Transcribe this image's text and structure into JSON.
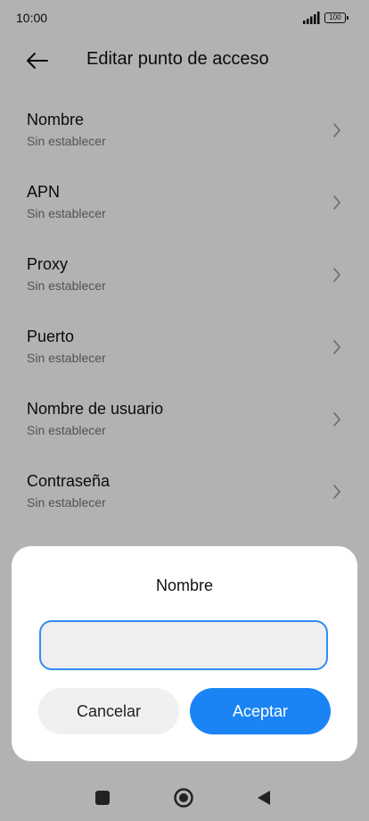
{
  "status_bar": {
    "time": "10:00",
    "battery": "100"
  },
  "header": {
    "title": "Editar punto de acceso",
    "back_icon": "arrow-left-icon"
  },
  "list": {
    "items": [
      {
        "title": "Nombre",
        "subtitle": "Sin establecer"
      },
      {
        "title": "APN",
        "subtitle": "Sin establecer"
      },
      {
        "title": "Proxy",
        "subtitle": "Sin establecer"
      },
      {
        "title": "Puerto",
        "subtitle": "Sin establecer"
      },
      {
        "title": "Nombre de usuario",
        "subtitle": "Sin establecer"
      },
      {
        "title": "Contraseña",
        "subtitle": "Sin establecer"
      }
    ]
  },
  "dialog": {
    "title": "Nombre",
    "input_value": "",
    "cancel_label": "Cancelar",
    "ok_label": "Aceptar"
  },
  "colors": {
    "accent": "#1a84f5",
    "input_border": "#2f8cf4",
    "scrim": "#9e9e9e"
  }
}
